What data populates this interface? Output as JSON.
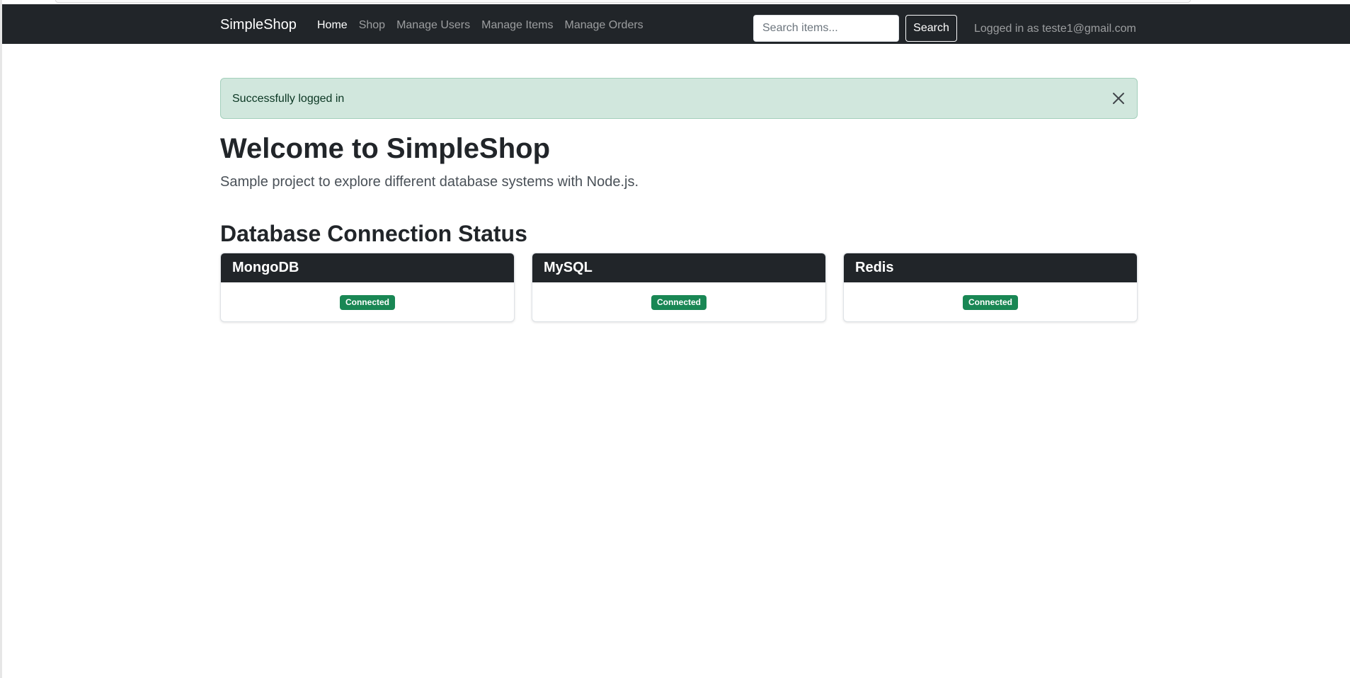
{
  "navbar": {
    "brand": "SimpleShop",
    "links": [
      {
        "label": "Home",
        "active": true
      },
      {
        "label": "Shop",
        "active": false
      },
      {
        "label": "Manage Users",
        "active": false
      },
      {
        "label": "Manage Items",
        "active": false
      },
      {
        "label": "Manage Orders",
        "active": false
      }
    ],
    "search": {
      "placeholder": "Search items...",
      "value": "",
      "button_label": "Search"
    },
    "user_status": "Logged in as teste1@gmail.com"
  },
  "alert": {
    "message": "Successfully logged in",
    "close_icon": "close-icon"
  },
  "main": {
    "title": "Welcome to SimpleShop",
    "lead": "Sample project to explore different database systems with Node.js.",
    "section_title": "Database Connection Status",
    "databases": [
      {
        "name": "MongoDB",
        "status": "Connected"
      },
      {
        "name": "MySQL",
        "status": "Connected"
      },
      {
        "name": "Redis",
        "status": "Connected"
      }
    ]
  },
  "colors": {
    "navbar": "#212529",
    "alert_bg": "#d1e7dd",
    "alert_text": "#0a3622",
    "badge_success": "#198754"
  }
}
